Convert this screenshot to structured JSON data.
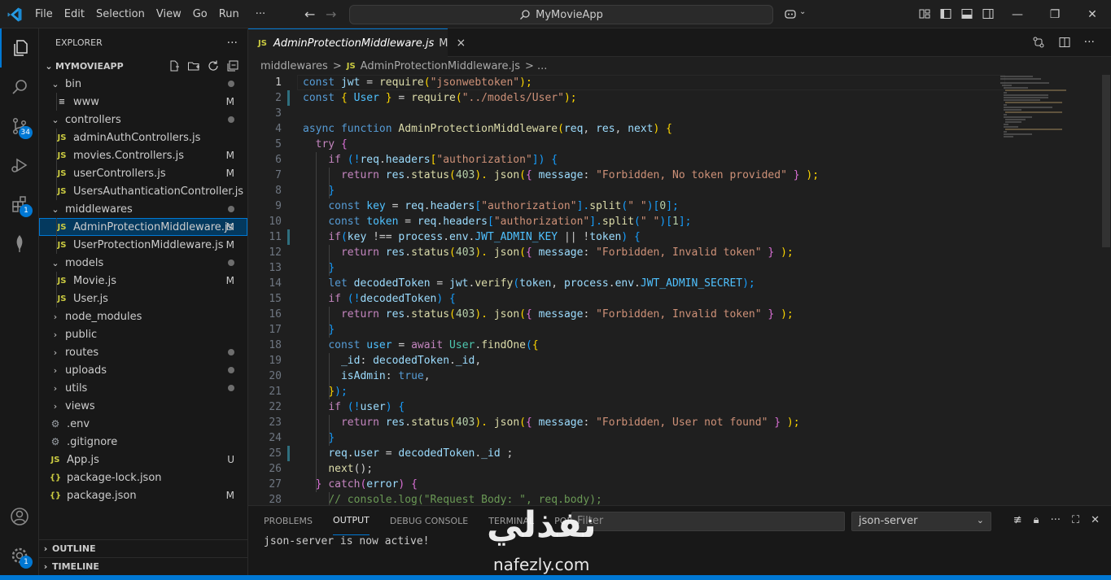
{
  "titlebar": {
    "menu": [
      "File",
      "Edit",
      "Selection",
      "View",
      "Go",
      "Run",
      "···"
    ],
    "search": "MyMovieApp",
    "colors": {
      "accent": "#0078d4"
    }
  },
  "activity": {
    "scm_badge": "34",
    "extensions_badge": "1",
    "settings_badge": "1"
  },
  "explorer": {
    "title": "EXPLORER",
    "more": "···",
    "root": "MYMOVIEAPP",
    "tree": [
      {
        "kind": "folder-open",
        "label": "bin",
        "depth": 1,
        "status": "dot"
      },
      {
        "kind": "file",
        "icon": "≡",
        "label": "www",
        "depth": 2,
        "status": "M"
      },
      {
        "kind": "folder-open",
        "label": "controllers",
        "depth": 1,
        "status": "dot"
      },
      {
        "kind": "js",
        "label": "adminAuthControllers.js",
        "depth": 2,
        "status": ""
      },
      {
        "kind": "js",
        "label": "movies.Controllers.js",
        "depth": 2,
        "status": "M"
      },
      {
        "kind": "js",
        "label": "userControllers.js",
        "depth": 2,
        "status": "M"
      },
      {
        "kind": "js",
        "label": "UsersAuthanticationController.js",
        "depth": 2,
        "status": ""
      },
      {
        "kind": "folder-open",
        "label": "middlewares",
        "depth": 1,
        "status": "dot"
      },
      {
        "kind": "js",
        "label": "AdminProtectionMiddleware.js",
        "depth": 2,
        "status": "M",
        "selected": true
      },
      {
        "kind": "js",
        "label": "UserProtectionMiddleware.js",
        "depth": 2,
        "status": "M"
      },
      {
        "kind": "folder-open",
        "label": "models",
        "depth": 1,
        "status": "dot"
      },
      {
        "kind": "js",
        "label": "Movie.js",
        "depth": 2,
        "status": "M"
      },
      {
        "kind": "js",
        "label": "User.js",
        "depth": 2,
        "status": ""
      },
      {
        "kind": "folder",
        "label": "node_modules",
        "depth": 1,
        "status": ""
      },
      {
        "kind": "folder",
        "label": "public",
        "depth": 1,
        "status": ""
      },
      {
        "kind": "folder",
        "label": "routes",
        "depth": 1,
        "status": "dot"
      },
      {
        "kind": "folder",
        "label": "uploads",
        "depth": 1,
        "status": "dot"
      },
      {
        "kind": "folder",
        "label": "utils",
        "depth": 1,
        "status": "dot"
      },
      {
        "kind": "folder",
        "label": "views",
        "depth": 1,
        "status": ""
      },
      {
        "kind": "env",
        "label": ".env",
        "depth": 1,
        "status": ""
      },
      {
        "kind": "git",
        "label": ".gitignore",
        "depth": 1,
        "status": ""
      },
      {
        "kind": "js",
        "label": "App.js",
        "depth": 1,
        "status": "U"
      },
      {
        "kind": "json",
        "label": "package-lock.json",
        "depth": 1,
        "status": ""
      },
      {
        "kind": "json",
        "label": "package.json",
        "depth": 1,
        "status": "M"
      }
    ],
    "outline": "OUTLINE",
    "timeline": "TIMELINE"
  },
  "editor": {
    "tab": {
      "lang": "JS",
      "label": "AdminProtectionMiddleware.js",
      "status": "M",
      "close": "×"
    },
    "breadcrumb": {
      "folder": "middlewares",
      "sep": ">",
      "lang": "JS",
      "file": "AdminProtectionMiddleware.js",
      "more": "> ..."
    },
    "lines": [
      "1",
      "2",
      "3",
      "4",
      "5",
      "6",
      "7",
      "8",
      "9",
      "10",
      "11",
      "12",
      "13",
      "14",
      "15",
      "16",
      "17",
      "18",
      "19",
      "20",
      "21",
      "22",
      "23",
      "24",
      "25",
      "26",
      "27",
      "28"
    ],
    "code": {
      "l1": [
        "const",
        "jwt",
        "=",
        "require",
        "(",
        "\"jsonwebtoken\"",
        ");"
      ],
      "l2": [
        "const",
        "{",
        "User",
        "}",
        "=",
        "require",
        "(",
        "\"../models/User\"",
        ");"
      ],
      "l4": [
        "async",
        "function",
        "AdminProtectionMiddleware",
        "(",
        "req",
        ", ",
        "res",
        ", ",
        "next",
        ")",
        "{"
      ],
      "l5": [
        "try",
        "{"
      ],
      "l6": [
        "if",
        "(!",
        "req",
        ".",
        "headers",
        "[",
        "\"authorization\"",
        "])",
        "{"
      ],
      "l7": [
        "return",
        "res",
        ".",
        "status",
        "(",
        "403",
        ").",
        "json",
        "(",
        "{",
        "message",
        ":",
        "\"Forbidden, No token provided\"",
        "}",
        ");"
      ],
      "l8": [
        "}"
      ],
      "l9": [
        "const",
        "key",
        "=",
        "req",
        ".",
        "headers",
        "[",
        "\"authorization\"",
        "].",
        "split",
        "(",
        "\" \"",
        ")",
        "[",
        "0",
        "];"
      ],
      "l10": [
        "const",
        "token",
        "=",
        "req",
        ".",
        "headers",
        "[",
        "\"authorization\"",
        "].",
        "split",
        "(",
        "\" \"",
        ")",
        "[",
        "1",
        "];"
      ],
      "l11": [
        "if",
        "(",
        "key",
        "!==",
        "process",
        ".",
        "env",
        ".",
        "JWT_ADMIN_KEY",
        "||",
        "!",
        "token",
        ")",
        "{"
      ],
      "l12": [
        "return",
        "res",
        ".",
        "status",
        "(",
        "403",
        ").",
        "json",
        "(",
        "{",
        "message",
        ":",
        "\"Forbidden, Invalid token\"",
        "}",
        ");"
      ],
      "l13": [
        "}"
      ],
      "l14": [
        "let",
        "decodedToken",
        "=",
        "jwt",
        ".",
        "verify",
        "(",
        "token",
        ", ",
        "process",
        ".",
        "env",
        ".",
        "JWT_ADMIN_SECRET",
        ");"
      ],
      "l15": [
        "if",
        "(!",
        "decodedToken",
        ")",
        "{"
      ],
      "l16": [
        "return",
        "res",
        ".",
        "status",
        "(",
        "403",
        ").",
        "json",
        "(",
        "{",
        "message",
        ":",
        "\"Forbidden, Invalid token\"",
        "}",
        ");"
      ],
      "l17": [
        "}"
      ],
      "l18": [
        "const",
        "user",
        "=",
        "await",
        "User",
        ".",
        "findOne",
        "(",
        "{"
      ],
      "l19": [
        "_id",
        ":",
        "decodedToken",
        ".",
        "_id",
        ","
      ],
      "l20": [
        "isAdmin",
        ":",
        "true",
        ","
      ],
      "l21": [
        "}",
        ");"
      ],
      "l22": [
        "if",
        "(!",
        "user",
        ")",
        "{"
      ],
      "l23": [
        "return",
        "res",
        ".",
        "status",
        "(",
        "403",
        ").",
        "json",
        "(",
        "{",
        "message",
        ":",
        "\"Forbidden, User not found\"",
        "}",
        ");"
      ],
      "l24": [
        "}"
      ],
      "l25": [
        "req",
        ".",
        "user",
        "=",
        "decodedToken",
        ".",
        "_id",
        ";"
      ],
      "l26": [
        "next",
        "();"
      ],
      "l27": [
        "}",
        "catch",
        "(",
        "error",
        ")",
        "{"
      ],
      "l28": [
        "// console.log(\"Request Body: \", req.body);"
      ]
    }
  },
  "panel": {
    "tabs": [
      "PROBLEMS",
      "OUTPUT",
      "DEBUG CONSOLE",
      "TERMINAL",
      "PORTS"
    ],
    "active_tab": "OUTPUT",
    "filter_placeholder": "Filter",
    "channel": "json-server",
    "output": "json-server is now active!"
  },
  "watermark": {
    "arabic": "نفذلي",
    "latin": "nafezly.com"
  }
}
